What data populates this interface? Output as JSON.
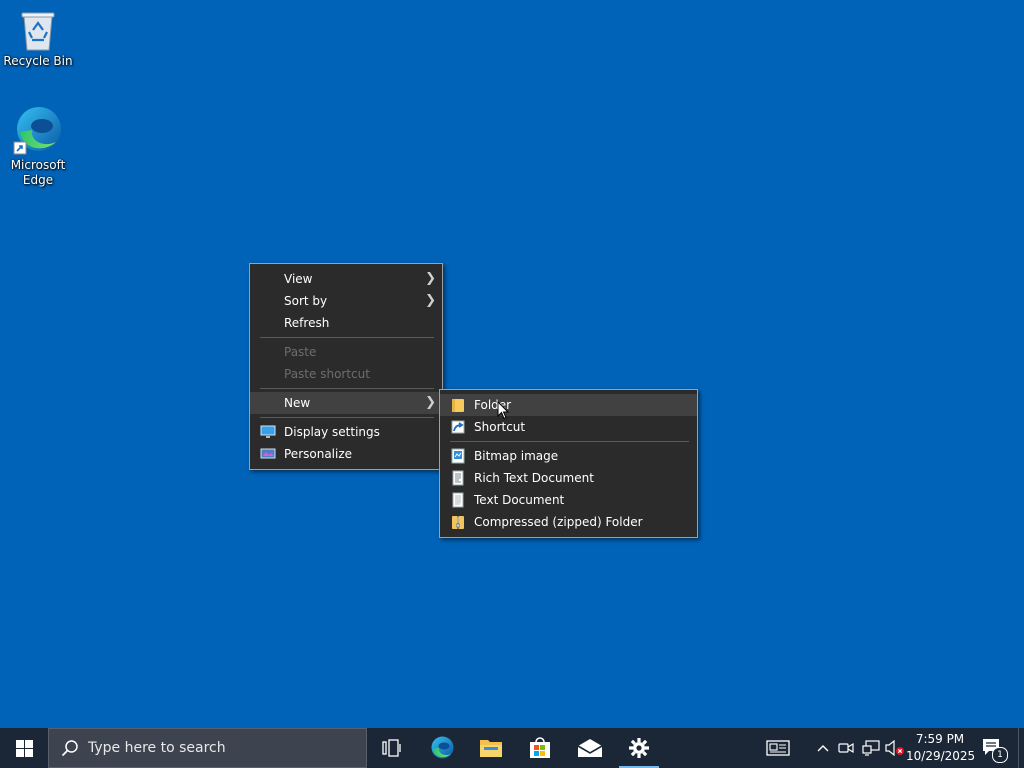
{
  "desktop": {
    "icons": [
      {
        "label": "Recycle Bin",
        "icon": "recycle-bin-icon"
      },
      {
        "label": "Microsoft Edge",
        "icon": "edge-icon"
      }
    ]
  },
  "context_menu": {
    "items": [
      {
        "label": "View",
        "submenu": true
      },
      {
        "label": "Sort by",
        "submenu": true
      },
      {
        "label": "Refresh"
      },
      {
        "label": "Paste",
        "disabled": true
      },
      {
        "label": "Paste shortcut",
        "disabled": true
      },
      {
        "label": "New",
        "submenu": true,
        "highlighted": true
      },
      {
        "label": "Display settings",
        "icon": "display-settings-icon"
      },
      {
        "label": "Personalize",
        "icon": "personalize-icon"
      }
    ]
  },
  "new_submenu": {
    "items": [
      {
        "label": "Folder",
        "icon": "folder-icon",
        "highlighted": true
      },
      {
        "label": "Shortcut",
        "icon": "shortcut-icon"
      },
      {
        "label": "Bitmap image",
        "icon": "bitmap-icon"
      },
      {
        "label": "Rich Text Document",
        "icon": "rich-text-icon"
      },
      {
        "label": "Text Document",
        "icon": "text-document-icon"
      },
      {
        "label": "Compressed (zipped) Folder",
        "icon": "zip-folder-icon"
      }
    ]
  },
  "taskbar": {
    "search_placeholder": "Type here to search",
    "apps": [
      "task-view-icon",
      "edge-icon",
      "file-explorer-icon",
      "store-icon",
      "mail-icon",
      "settings-icon"
    ],
    "active_app": "settings-icon",
    "clock": {
      "time": "7:59 PM",
      "date": "10/29/2025"
    },
    "notification_count": "1"
  },
  "colors": {
    "desktop": "#0063b8",
    "menu_bg": "#2b2b2b",
    "menu_highlight": "#414141",
    "taskbar_bg": "#1b2736",
    "search_bg": "#3d4450",
    "accent": "#76b9ed"
  }
}
